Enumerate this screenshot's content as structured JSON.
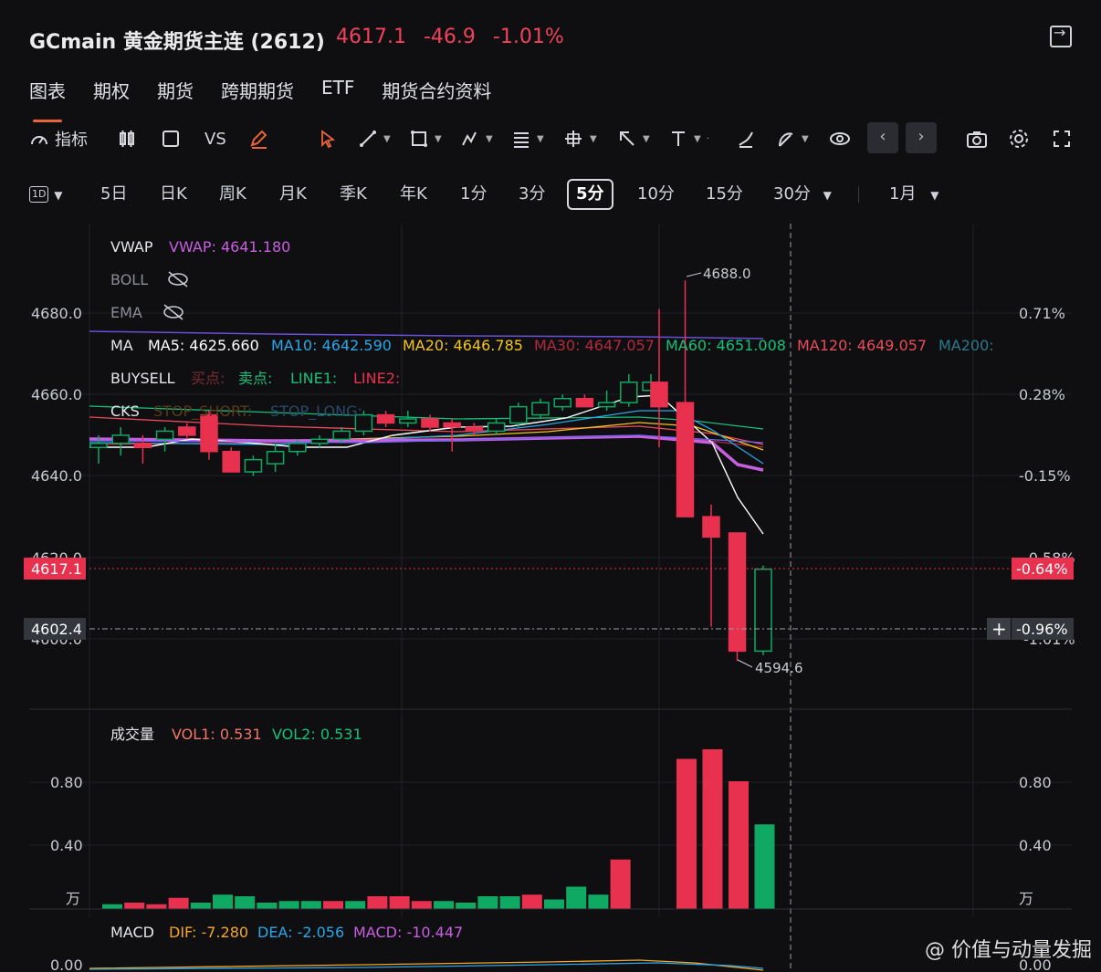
{
  "header": {
    "title": "GCmain 黄金期货主连 (2612)",
    "price": "4617.1",
    "change": "-46.9",
    "change_pct": "-1.01%"
  },
  "tabs": [
    {
      "label": "图表",
      "active": true
    },
    {
      "label": "期权"
    },
    {
      "label": "期货"
    },
    {
      "label": "跨期期货"
    },
    {
      "label": "ETF"
    },
    {
      "label": "期货合约资料"
    }
  ],
  "toolbar": {
    "indicator_label": "指标",
    "vs_label": "VS"
  },
  "periods": {
    "selector": "1D",
    "items": [
      "5日",
      "日K",
      "周K",
      "月K",
      "季K",
      "年K",
      "1分",
      "3分",
      "5分",
      "10分",
      "15分",
      "30分"
    ],
    "active": "5分",
    "range": "1月"
  },
  "indicators": {
    "vwap_label": "VWAP",
    "vwap_value": "VWAP: 4641.180",
    "boll_label": "BOLL",
    "ema_label": "EMA",
    "ma_label": "MA",
    "ma5": "MA5: 4625.660",
    "ma10": "MA10: 4642.590",
    "ma20": "MA20: 4646.785",
    "ma30": "MA30: 4647.057",
    "ma60": "MA60: 4651.008",
    "ma120": "MA120: 4649.057",
    "ma200": "MA200:",
    "buysell_label": "BUYSELL",
    "buy_point": "买点:",
    "sell_point": "卖点:",
    "line1": "LINE1:",
    "line2": "LINE2:",
    "cks_label": "CKS",
    "stop_short": "STOP_SHORT:",
    "stop_long": "STOP_LONG:"
  },
  "volume_panel": {
    "label": "成交量",
    "vol1": "VOL1: 0.531",
    "vol2": "VOL2: 0.531",
    "unit": "万"
  },
  "macd_panel": {
    "label": "MACD",
    "dif": "DIF: -7.280",
    "dea": "DEA: -2.056",
    "macd": "MACD: -10.447"
  },
  "price_labels": {
    "current": "4617.1",
    "current_pct": "-0.64%",
    "crosshair": "4602.4",
    "crosshair_pct": "-0.96%",
    "high_marker": "4688.0",
    "low_marker": "4594.6"
  },
  "colors": {
    "up": "#0fa964",
    "down": "#e8314f",
    "accent": "#e8643a",
    "vwap": "#c85ee0",
    "ma5": "#ffffff",
    "ma10": "#2aa7e8",
    "ma20": "#f5c518",
    "ma30": "#e8314f",
    "ma60": "#17c07a",
    "ma120": "#e84c5a",
    "ma200": "#2b7a8c"
  },
  "chart_data": {
    "type": "candlestick",
    "y_ticks_left": [
      "4680.0",
      "4660.0",
      "4640.0",
      "4620.0",
      "4600.0"
    ],
    "y_ticks_right": [
      "0.71%",
      "0.28%",
      "-0.15%",
      "-0.58%",
      "-1.01%"
    ],
    "ylim": [
      4590,
      4695
    ],
    "candles": [
      {
        "o": 4647,
        "h": 4650,
        "l": 4643,
        "c": 4648
      },
      {
        "o": 4648,
        "h": 4652,
        "l": 4645,
        "c": 4650
      },
      {
        "o": 4648,
        "h": 4650,
        "l": 4643,
        "c": 4647
      },
      {
        "o": 4649,
        "h": 4652,
        "l": 4646,
        "c": 4651
      },
      {
        "o": 4652,
        "h": 4653,
        "l": 4649,
        "c": 4650
      },
      {
        "o": 4655,
        "h": 4656,
        "l": 4644,
        "c": 4646
      },
      {
        "o": 4646,
        "h": 4647,
        "l": 4641,
        "c": 4641
      },
      {
        "o": 4641,
        "h": 4645,
        "l": 4640,
        "c": 4644
      },
      {
        "o": 4643,
        "h": 4648,
        "l": 4641,
        "c": 4646
      },
      {
        "o": 4646,
        "h": 4649,
        "l": 4645,
        "c": 4648
      },
      {
        "o": 4648,
        "h": 4650,
        "l": 4647,
        "c": 4649
      },
      {
        "o": 4649,
        "h": 4652,
        "l": 4648,
        "c": 4651
      },
      {
        "o": 4651,
        "h": 4656,
        "l": 4650,
        "c": 4655
      },
      {
        "o": 4655,
        "h": 4656,
        "l": 4652,
        "c": 4653
      },
      {
        "o": 4653,
        "h": 4656,
        "l": 4652,
        "c": 4654
      },
      {
        "o": 4654,
        "h": 4655,
        "l": 4651,
        "c": 4652
      },
      {
        "o": 4653,
        "h": 4654,
        "l": 4646,
        "c": 4652
      },
      {
        "o": 4652,
        "h": 4653,
        "l": 4650,
        "c": 4651
      },
      {
        "o": 4651,
        "h": 4654,
        "l": 4650,
        "c": 4653
      },
      {
        "o": 4653,
        "h": 4658,
        "l": 4652,
        "c": 4657
      },
      {
        "o": 4655,
        "h": 4659,
        "l": 4654,
        "c": 4658
      },
      {
        "o": 4657,
        "h": 4660,
        "l": 4656,
        "c": 4659
      },
      {
        "o": 4659,
        "h": 4660,
        "l": 4657,
        "c": 4657
      },
      {
        "o": 4657,
        "h": 4661,
        "l": 4656,
        "c": 4658
      },
      {
        "o": 4658,
        "h": 4665,
        "l": 4657,
        "c": 4663
      },
      {
        "o": 4661,
        "h": 4665,
        "l": 4659,
        "c": 4663
      },
      {
        "o": 4663,
        "h": 4681,
        "l": 4647,
        "c": 4657
      },
      {
        "o": 4658,
        "h": 4688,
        "l": 4630,
        "c": 4630
      },
      {
        "o": 4630,
        "h": 4633,
        "l": 4603,
        "c": 4625
      },
      {
        "o": 4626,
        "h": 4626,
        "l": 4594.6,
        "c": 4597
      },
      {
        "o": 4597,
        "h": 4618,
        "l": 4596,
        "c": 4617.1
      }
    ],
    "volume": {
      "y_ticks": [
        "0.80",
        "0.40"
      ],
      "ylim": [
        0,
        1.0
      ],
      "values": [
        0.03,
        0.04,
        0.03,
        0.07,
        0.04,
        0.09,
        0.08,
        0.04,
        0.05,
        0.05,
        0.05,
        0.05,
        0.08,
        0.08,
        0.05,
        0.05,
        0.04,
        0.08,
        0.08,
        0.09,
        0.06,
        0.14,
        0.09,
        0.31,
        0.94,
        1.0,
        0.8,
        0.53
      ]
    },
    "macd": {
      "y_ticks": [
        "0.00"
      ]
    }
  },
  "watermark": "@ 价值与动量发掘"
}
